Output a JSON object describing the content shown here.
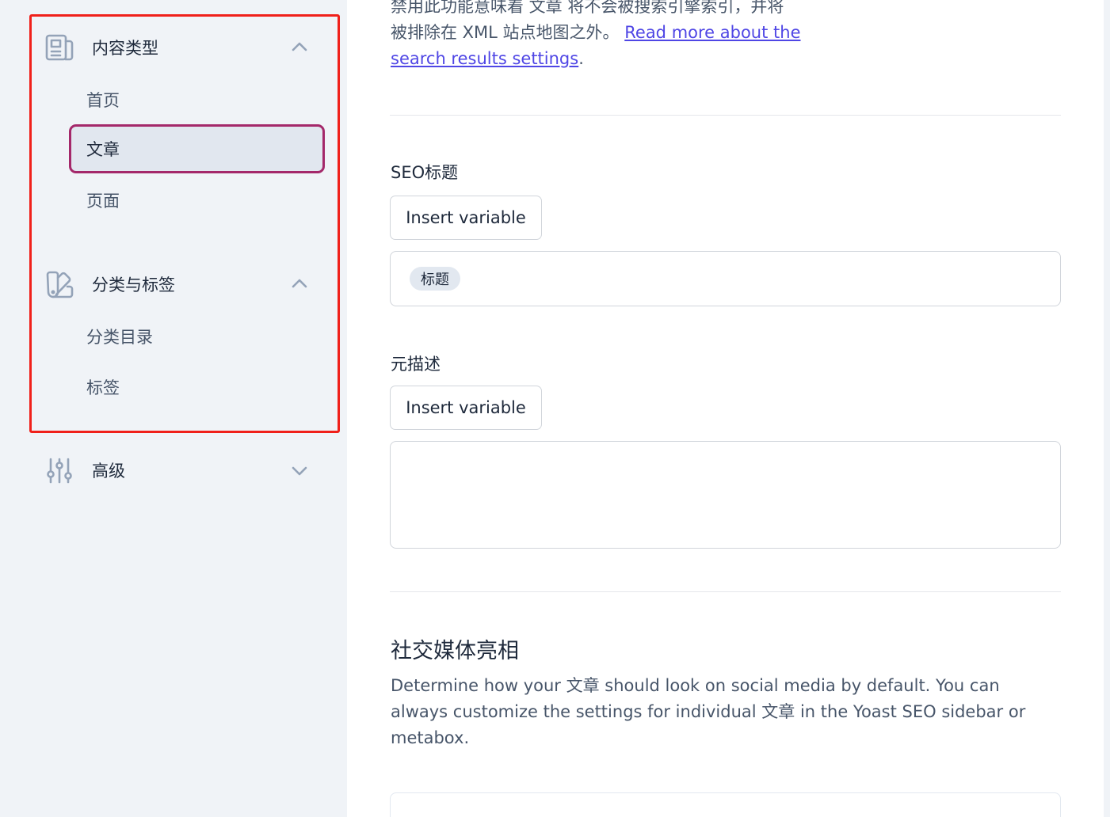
{
  "sidebar": {
    "groups": [
      {
        "label": "内容类型",
        "icon": "newspaper-icon",
        "expanded": true,
        "items": [
          {
            "label": "首页",
            "active": false
          },
          {
            "label": "文章",
            "active": true
          },
          {
            "label": "页面",
            "active": false
          }
        ]
      },
      {
        "label": "分类与标签",
        "icon": "color-swatch-icon",
        "expanded": true,
        "items": [
          {
            "label": "分类目录",
            "active": false
          },
          {
            "label": "标签",
            "active": false
          }
        ]
      },
      {
        "label": "高级",
        "icon": "adjustments-icon",
        "expanded": false,
        "items": []
      }
    ]
  },
  "main": {
    "intro": {
      "line1": "禁用此功能意味着 文章 将不会被搜索引擎索引，并将",
      "line2": "被排除在 XML 站点地图之外。",
      "link_part1": "Read more about the",
      "link_part2": "search results settings",
      "period": "."
    },
    "seo_title": {
      "label": "SEO标题",
      "insert_button": "Insert variable",
      "chip": "标题"
    },
    "meta_description": {
      "label": "元描述",
      "insert_button": "Insert variable",
      "value": ""
    },
    "social": {
      "title": "社交媒体亮相",
      "description": "Determine how your 文章 should look on social media by default. You can always customize the settings for individual 文章 in the Yoast SEO sidebar or metabox."
    }
  },
  "colors": {
    "highlight": "#f0201a",
    "active_border": "#a4286a",
    "link": "#4f46e5"
  }
}
